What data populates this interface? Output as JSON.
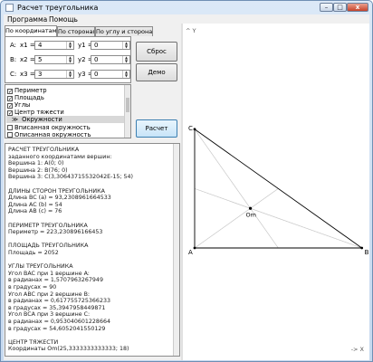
{
  "window": {
    "title": "Расчет треугольника",
    "btn_min": "–",
    "btn_max": "□",
    "btn_close": "x"
  },
  "menu": {
    "items": [
      "Программа",
      "Помощь"
    ]
  },
  "tabs": [
    "По координатам",
    "По сторонам",
    "По углу и сторонам"
  ],
  "coords": {
    "a_label": "A:",
    "b_label": "B:",
    "c_label": "C:",
    "x1_label": "x1 =",
    "y1_label": "y1 =",
    "x2_label": "x2 =",
    "y2_label": "y2 =",
    "x3_label": "x3 =",
    "y3_label": "y3 =",
    "x1": "4",
    "y1": "0",
    "x2": "5",
    "y2": "0",
    "x3": "3",
    "y3": "0"
  },
  "buttons": {
    "reset": "Сброс",
    "demo": "Демо",
    "calc": "Расчет"
  },
  "checklist": [
    {
      "label": "Периметр",
      "checked": true
    },
    {
      "label": "Площадь",
      "checked": true
    },
    {
      "label": "Углы",
      "checked": true
    },
    {
      "label": "Центр тяжести",
      "checked": true
    },
    {
      "label": "Окружности",
      "group": true
    },
    {
      "label": "Вписанная окружность",
      "checked": false
    },
    {
      "label": "Описанная окружность",
      "checked": false
    }
  ],
  "output": [
    "РАСЧЕТ ТРЕУГОЛЬНИКА",
    "заданного координатами вершин:",
    "  Вершина 1: A(0; 0)",
    "  Вершина 2: B(76; 0)",
    "  Вершина 3: C(3,30643715532042E-15; 54)",
    "",
    "ДЛИНЫ СТОРОН ТРЕУГОЛЬНИКА",
    "  Длина BC (a) = 93,2308961664533",
    "  Длина AC (b) = 54",
    "  Длина AB (c) = 76",
    "",
    "ПЕРИМЕТР ТРЕУГОЛЬНИКА",
    "  Периметр = 223,230896166453",
    "",
    "ПЛОЩАДЬ ТРЕУГОЛЬНИКА",
    "  Площадь = 2052",
    "",
    "УГЛЫ ТРЕУГОЛЬНИКА",
    "  Угол BAC при 1 вершине A:",
    "    в радианах = 1,5707963267949",
    "    в градусах = 90",
    "  Угол ABC при 2 вершине B:",
    "    в радианах = 0,617755725366233",
    "    в градусах = 35,3947958449871",
    "  Угол BCA при 3 вершине C:",
    "    в радианах = 0,953040601228664",
    "    в градусах = 54,6052041550129",
    "",
    "ЦЕНТР ТЯЖЕСТИ",
    "  Координаты Om(25,3333333333333; 18)"
  ],
  "plot": {
    "y_axis_label": "^ Y",
    "x_axis_label": "-> X",
    "vertices": [
      {
        "name": "A",
        "x": 0,
        "y": 0
      },
      {
        "name": "B",
        "x": 76,
        "y": 0
      },
      {
        "name": "C",
        "x": 0,
        "y": 54
      }
    ],
    "centroid": {
      "name": "Om",
      "x": 25.3333333333333,
      "y": 18
    }
  }
}
